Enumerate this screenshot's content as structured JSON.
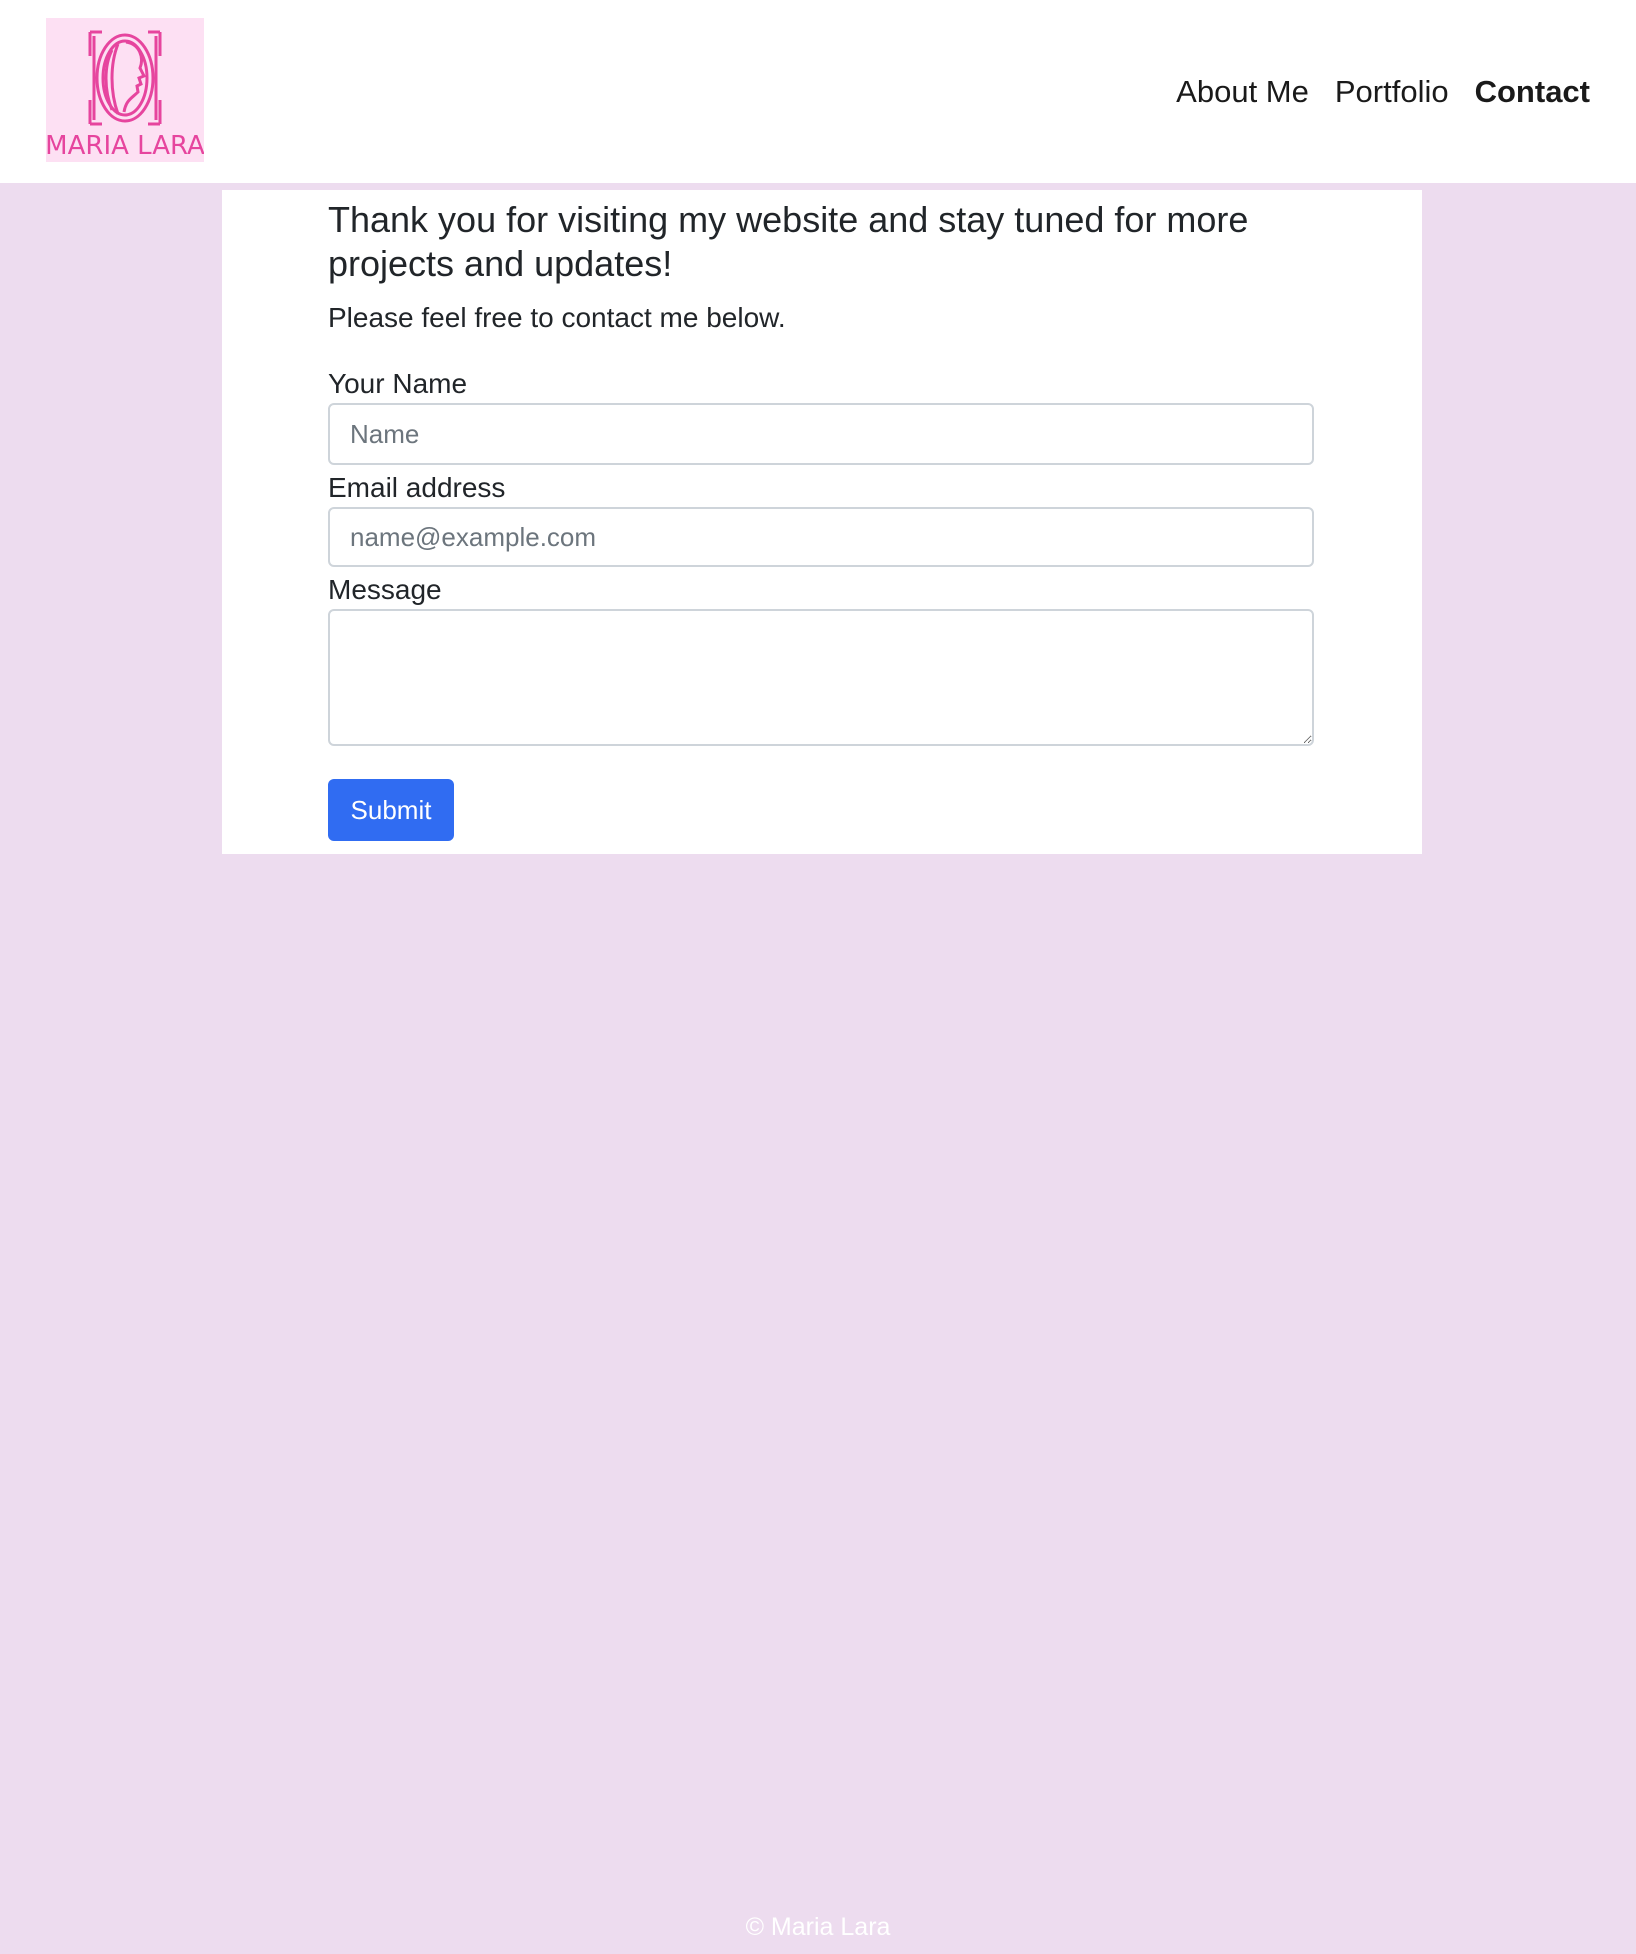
{
  "header": {
    "logo_text": "MARIA LARA",
    "nav": [
      {
        "label": "About Me",
        "active": false
      },
      {
        "label": "Portfolio",
        "active": false
      },
      {
        "label": "Contact",
        "active": true
      }
    ]
  },
  "main": {
    "heading": "Thank you for visiting my website and stay tuned for more projects and updates!",
    "subtext": "Please feel free to contact me below.",
    "form": {
      "name_label": "Your Name",
      "name_placeholder": "Name",
      "name_value": "",
      "email_label": "Email address",
      "email_placeholder": "name@example.com",
      "email_value": "",
      "message_label": "Message",
      "message_value": "",
      "submit_label": "Submit"
    }
  },
  "footer": {
    "text": "© Maria Lara"
  },
  "colors": {
    "page_background": "#eddcef",
    "logo_pink": "#e6459e",
    "logo_background": "#fde0f3",
    "submit_button": "#306cf2"
  }
}
